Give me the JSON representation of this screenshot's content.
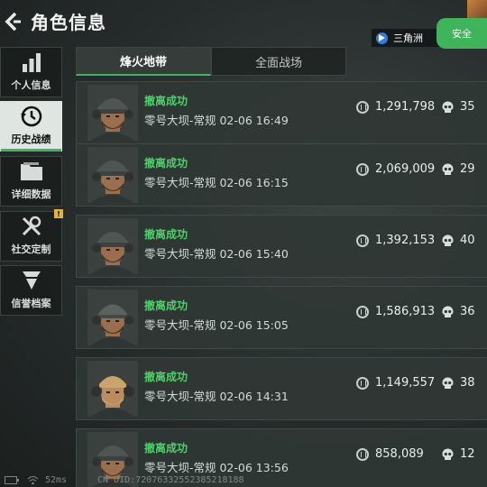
{
  "header": {
    "title": "角色信息",
    "game_badge": "三角洲",
    "safe_label": "安全"
  },
  "sidebar": {
    "items": [
      {
        "label": "个人信息",
        "icon": "bar-chart-icon",
        "active": false
      },
      {
        "label": "历史战绩",
        "icon": "clock-history-icon",
        "active": true
      },
      {
        "label": "详细数据",
        "icon": "folder-icon",
        "active": false
      },
      {
        "label": "社交定制",
        "icon": "tools-icon",
        "active": false,
        "badge": "!"
      },
      {
        "label": "信誉档案",
        "icon": "chevron-rank-icon",
        "active": false
      }
    ]
  },
  "tabs": [
    {
      "label": "烽火地带",
      "active": true
    },
    {
      "label": "全面战场",
      "active": false
    }
  ],
  "records": [
    {
      "result": "撤离成功",
      "detail": "零号大坝-常规 02-06 16:49",
      "value": "1,291,798",
      "kills": "35",
      "helmet": true
    },
    {
      "result": "撤离成功",
      "detail": "零号大坝-常规 02-06 16:15",
      "value": "2,069,009",
      "kills": "29",
      "helmet": true
    },
    {
      "result": "撤离成功",
      "detail": "零号大坝-常规 02-06 15:40",
      "value": "1,392,153",
      "kills": "40",
      "helmet": true
    },
    {
      "result": "撤离成功",
      "detail": "零号大坝-常规 02-06 15:05",
      "value": "1,586,913",
      "kills": "36",
      "helmet": false
    },
    {
      "result": "撤离成功",
      "detail": "零号大坝-常规 02-06 14:31",
      "value": "1,149,557",
      "kills": "38",
      "helmet": false,
      "blond": true
    },
    {
      "result": "撤离成功",
      "detail": "零号大坝-常规 02-06 13:56",
      "value": "858,089",
      "kills": "12",
      "helmet": true
    }
  ],
  "footer": {
    "ping": "52ms",
    "uid": "CN UID:7207633255238521818​8"
  },
  "colors": {
    "accent_green": "#3fb45a",
    "result_green": "#4fd06a",
    "badge_yellow": "#e2b53a"
  }
}
